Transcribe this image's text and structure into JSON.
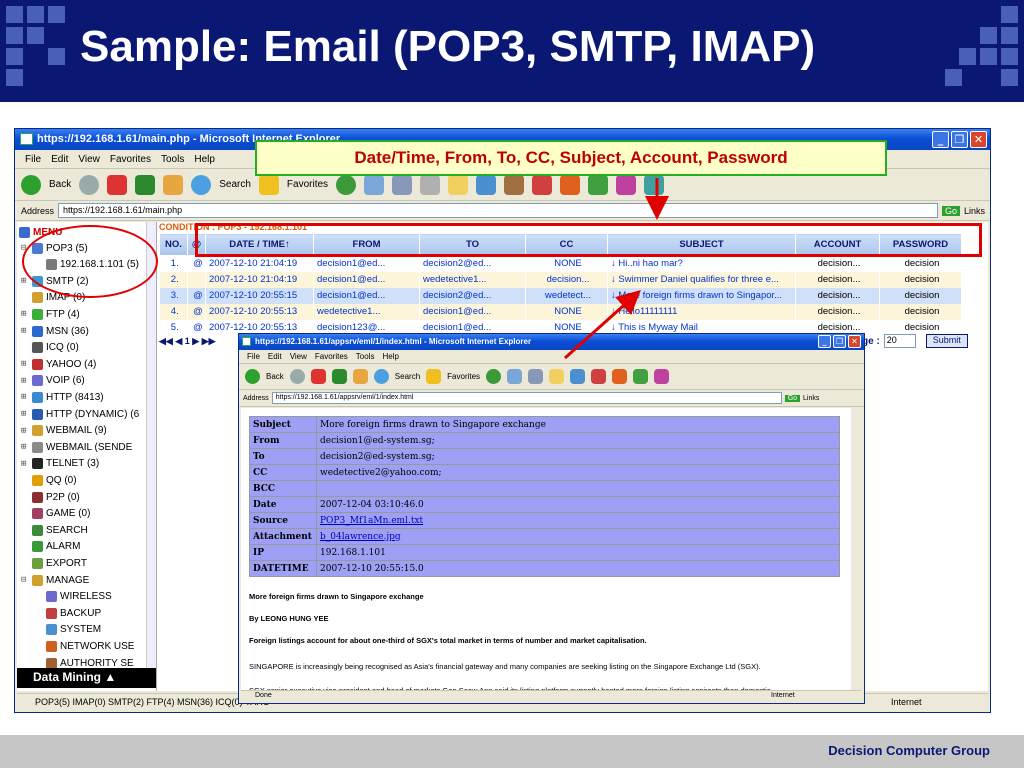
{
  "slide": {
    "title": "Sample: Email (POP3, SMTP, IMAP)",
    "footer": "Decision Computer Group",
    "callout": "Date/Time, From, To, CC, Subject, Account, Password"
  },
  "browser": {
    "title": "https://192.168.1.61/main.php - Microsoft Internet Explorer",
    "menu": [
      "File",
      "Edit",
      "View",
      "Favorites",
      "Tools",
      "Help"
    ],
    "toolbar": {
      "back": "Back",
      "search": "Search",
      "favorites": "Favorites"
    },
    "address_label": "Address",
    "address": "https://192.168.1.61/main.php",
    "go": "Go",
    "links": "Links",
    "status": "POP3(5) IMAP(0) SMTP(2) FTP(4) MSN(36) ICQ(0) YAHO",
    "status_zone": "Internet"
  },
  "tree": {
    "menu_label": "MENU",
    "items": [
      {
        "label": "POP3 (5)",
        "indent": 1,
        "expander": "⊟"
      },
      {
        "label": "192.168.1.101 (5)",
        "indent": 2,
        "expander": ""
      },
      {
        "label": "SMTP (2)",
        "indent": 1,
        "expander": "⊞"
      },
      {
        "label": "IMAP (0)",
        "indent": 1,
        "expander": ""
      },
      {
        "label": "FTP (4)",
        "indent": 1,
        "expander": "⊞"
      },
      {
        "label": "MSN (36)",
        "indent": 1,
        "expander": "⊞"
      },
      {
        "label": "ICQ (0)",
        "indent": 1,
        "expander": ""
      },
      {
        "label": "YAHOO (4)",
        "indent": 1,
        "expander": "⊞"
      },
      {
        "label": "VOIP (6)",
        "indent": 1,
        "expander": "⊞"
      },
      {
        "label": "HTTP (8413)",
        "indent": 1,
        "expander": "⊞"
      },
      {
        "label": "HTTP (DYNAMIC) (6",
        "indent": 1,
        "expander": "⊞"
      },
      {
        "label": "WEBMAIL (9)",
        "indent": 1,
        "expander": "⊞"
      },
      {
        "label": "WEBMAIL (SENDE",
        "indent": 1,
        "expander": "⊞"
      },
      {
        "label": "TELNET (3)",
        "indent": 1,
        "expander": "⊞"
      },
      {
        "label": "QQ (0)",
        "indent": 1,
        "expander": ""
      },
      {
        "label": "P2P (0)",
        "indent": 1,
        "expander": ""
      },
      {
        "label": "GAME (0)",
        "indent": 1,
        "expander": ""
      },
      {
        "label": "SEARCH",
        "indent": 1,
        "expander": ""
      },
      {
        "label": "ALARM",
        "indent": 1,
        "expander": ""
      },
      {
        "label": "EXPORT",
        "indent": 1,
        "expander": ""
      },
      {
        "label": "MANAGE",
        "indent": 1,
        "expander": "⊟"
      },
      {
        "label": "WIRELESS",
        "indent": 2,
        "expander": ""
      },
      {
        "label": "BACKUP",
        "indent": 2,
        "expander": ""
      },
      {
        "label": "SYSTEM",
        "indent": 2,
        "expander": ""
      },
      {
        "label": "NETWORK USE",
        "indent": 2,
        "expander": ""
      },
      {
        "label": "AUTHORITY SE",
        "indent": 2,
        "expander": ""
      }
    ],
    "data_mining": "Data Mining ▲"
  },
  "grid": {
    "condition": "CONDITION : POP3 - 192.168.1.101",
    "headers": [
      "NO.",
      "@",
      "DATE / TIME↑",
      "FROM",
      "TO",
      "CC",
      "SUBJECT",
      "ACCOUNT",
      "PASSWORD"
    ],
    "rows": [
      [
        "1.",
        "@",
        "2007-12-10 21:04:19",
        "decision1@ed...",
        "decision2@ed...",
        "NONE",
        "↓ Hi..ni hao mar?",
        "decision...",
        "decision"
      ],
      [
        "2.",
        "",
        "2007-12-10 21:04:19",
        "decision1@ed...",
        "wedetective1...",
        "decision...",
        "↓ Swimmer Daniel qualifies for three e...",
        "decision...",
        "decision"
      ],
      [
        "3.",
        "@",
        "2007-12-10 20:55:15",
        "decision1@ed...",
        "decision2@ed...",
        "wedetect...",
        "↓ More foreign firms drawn to Singapor...",
        "decision...",
        "decision"
      ],
      [
        "4.",
        "@",
        "2007-12-10 20:55:13",
        "wedetective1...",
        "decision1@ed...",
        "NONE",
        "↓ Hello11111111",
        "decision...",
        "decision"
      ],
      [
        "5.",
        "@",
        "2007-12-10 20:55:13",
        "decision123@...",
        "decision1@ed...",
        "NONE",
        "↓ This is Myway Mail",
        "decision...",
        "decision"
      ]
    ],
    "pager": "◀◀ ◀ 1 ▶ ▶▶",
    "page_label": "ge :",
    "page_value": "20",
    "submit": "Submit"
  },
  "popup": {
    "title": "https://192.168.1.61/appsrv/eml/1/index.html - Microsoft Internet Explorer",
    "menu": [
      "File",
      "Edit",
      "View",
      "Favorites",
      "Tools",
      "Help"
    ],
    "toolbar": {
      "back": "Back",
      "search": "Search",
      "favorites": "Favorites"
    },
    "address_label": "Address",
    "address": "https://192.168.1.61/appsrv/eml/1/index.html",
    "go": "Go",
    "links": "Links",
    "status_left": "Done",
    "status_zone": "Internet",
    "fields": [
      {
        "key": "Subject",
        "value": "More foreign firms drawn to Singapore exchange",
        "link": false
      },
      {
        "key": "From",
        "value": "decision1@ed-system.sg;",
        "link": false
      },
      {
        "key": "To",
        "value": "decision2@ed-system.sg;",
        "link": false
      },
      {
        "key": "CC",
        "value": "wedetective2@yahoo.com;",
        "link": false
      },
      {
        "key": "BCC",
        "value": "",
        "link": false
      },
      {
        "key": "Date",
        "value": "2007-12-04 03:10:46.0",
        "link": false
      },
      {
        "key": "Source",
        "value": "POP3_Mf1aMn.eml.txt",
        "link": true
      },
      {
        "key": "Attachment",
        "value": "b_04lawrence.jpg",
        "link": true
      },
      {
        "key": "IP",
        "value": "192.168.1.101",
        "link": false
      },
      {
        "key": "DATETIME",
        "value": "2007-12-10 20:55:15.0",
        "link": false
      }
    ],
    "body": [
      "More foreign firms drawn to Singapore exchange",
      "By LEONG HUNG YEE",
      "Foreign listings account for about one-third of SGX's total market in terms of number and market capitalisation.",
      "SINGAPORE is increasingly being recognised as Asia's financial gateway and many companies are seeking listing on the Singapore Exchange Ltd (SGX).",
      "SGX senior executive vice-president and head of markets Gan Seow Ann said its listing platform currently hosted more foreign listing aspirants than domestic"
    ]
  },
  "colors": {
    "slide_navy": "#0a1873",
    "annotation_red": "#e00000",
    "callout_green": "#22b022"
  }
}
